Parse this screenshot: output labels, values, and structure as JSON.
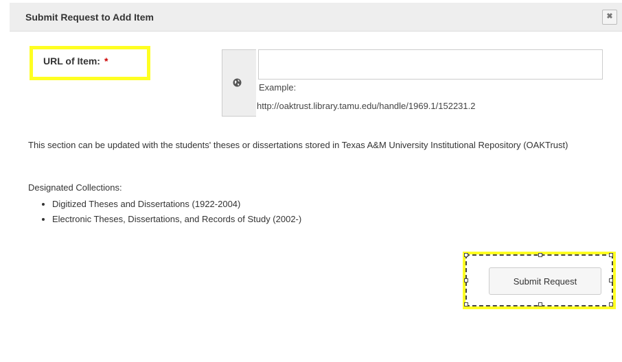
{
  "dialog": {
    "title": "Submit Request to Add Item",
    "close_icon": "close-icon",
    "close_glyph": "✖"
  },
  "form": {
    "url_label": "URL of Item:",
    "required_marker": "*",
    "url_icon": "globe-icon",
    "url_value": "",
    "example_label": "Example:",
    "example_url": "http://oaktrust.library.tamu.edu/handle/1969.1/152231.2"
  },
  "description": "This section can be updated with the students' theses or dissertations stored in Texas A&M University Institutional Repository (OAKTrust)",
  "collections": {
    "heading": "Designated Collections:",
    "items": [
      "Digitized Theses and Dissertations (1922-2004)",
      "Electronic Theses, Dissertations, and Records of Study (2002-)"
    ]
  },
  "actions": {
    "submit_label": "Submit Request"
  },
  "colors": {
    "highlight": "#ffff22",
    "required": "#cc0000",
    "titlebar_bg": "#eeeeee"
  }
}
